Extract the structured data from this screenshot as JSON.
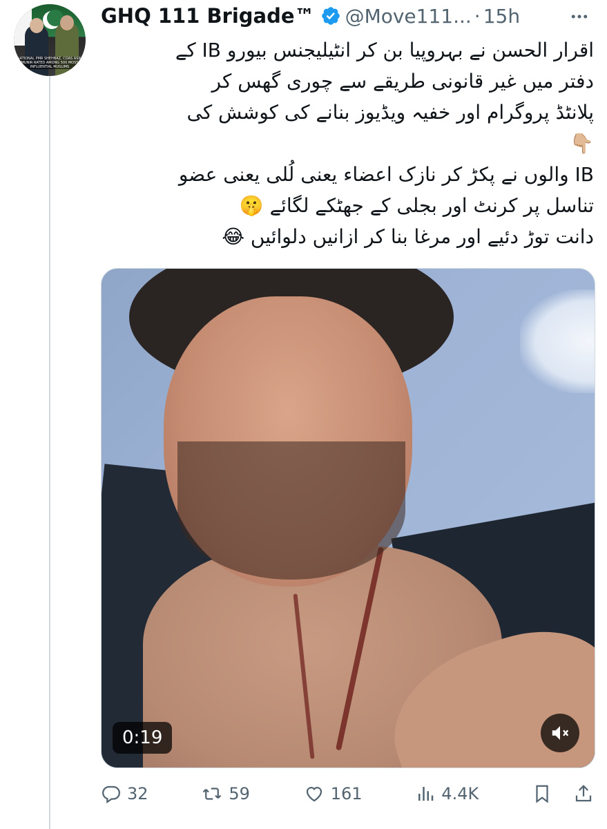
{
  "author": {
    "display_name": "GHQ 111 Brigade™",
    "handle": "@Move111...",
    "separator": "·",
    "time": "15h",
    "avatar_caption": "NATIONAL PMR SHEHBAZ, COAS ASIM MUNIR RATED AMONG 500 MOST INFLUENTIAL MUSLIMS"
  },
  "tweet": {
    "lines": [
      "اقرار الحسن نے بہروپیا بن کر انٹیلیجنس بیورو IB کے",
      "دفتر میں غیر قانونی طریقے سے چوری گھس کر",
      "پلانٹڈ پروگرام اور خفیہ ویڈیوز بنانے کی کوشش کی",
      "👇🏼",
      "IB والوں نے پکڑ کر نازک اعضاء یعنی لُلی یعنی عضو",
      "تناسل پر کرنٹ اور بجلی کے جھٹکے لگائے 🤫",
      "دانت توڑ دئیے اور مرغا بنا کر ازانیں دلوائیں 😂"
    ]
  },
  "video": {
    "duration": "0:19"
  },
  "actions": {
    "replies": "32",
    "reposts": "59",
    "likes": "161",
    "views": "4.4K"
  },
  "colors": {
    "verified": "#1d9bf0",
    "secondary_text": "#536471",
    "thread_line": "#cfd9de"
  },
  "icons": [
    "more-icon",
    "verified-badge-icon",
    "mute-icon",
    "reply-icon",
    "repost-icon",
    "like-icon",
    "views-icon",
    "bookmark-icon",
    "share-icon"
  ]
}
